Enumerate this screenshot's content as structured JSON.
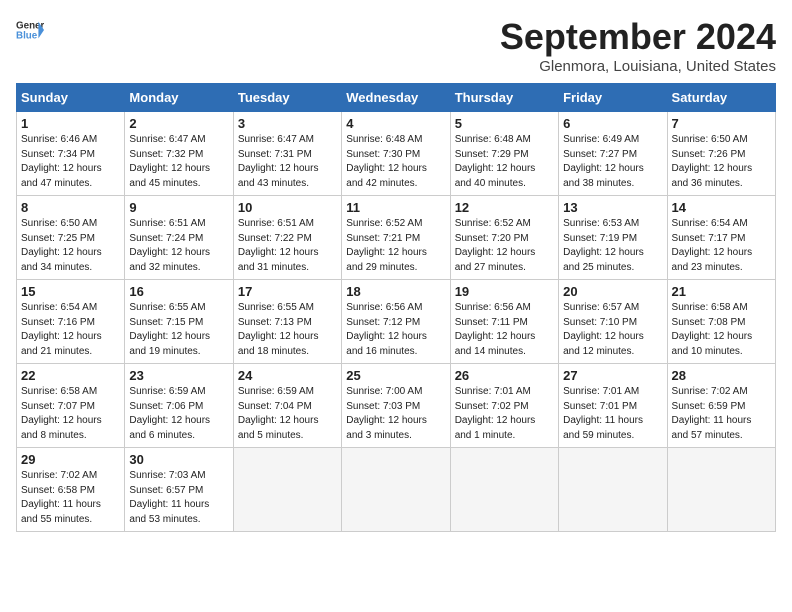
{
  "header": {
    "logo_line1": "General",
    "logo_line2": "Blue",
    "month": "September 2024",
    "location": "Glenmora, Louisiana, United States"
  },
  "weekdays": [
    "Sunday",
    "Monday",
    "Tuesday",
    "Wednesday",
    "Thursday",
    "Friday",
    "Saturday"
  ],
  "weeks": [
    [
      {
        "day": "1",
        "rise": "6:46 AM",
        "set": "7:34 PM",
        "hours": "12 hours",
        "mins": "47 minutes"
      },
      {
        "day": "2",
        "rise": "6:47 AM",
        "set": "7:32 PM",
        "hours": "12 hours",
        "mins": "45 minutes"
      },
      {
        "day": "3",
        "rise": "6:47 AM",
        "set": "7:31 PM",
        "hours": "12 hours",
        "mins": "43 minutes"
      },
      {
        "day": "4",
        "rise": "6:48 AM",
        "set": "7:30 PM",
        "hours": "12 hours",
        "mins": "42 minutes"
      },
      {
        "day": "5",
        "rise": "6:48 AM",
        "set": "7:29 PM",
        "hours": "12 hours",
        "mins": "40 minutes"
      },
      {
        "day": "6",
        "rise": "6:49 AM",
        "set": "7:27 PM",
        "hours": "12 hours",
        "mins": "38 minutes"
      },
      {
        "day": "7",
        "rise": "6:50 AM",
        "set": "7:26 PM",
        "hours": "12 hours",
        "mins": "36 minutes"
      }
    ],
    [
      {
        "day": "8",
        "rise": "6:50 AM",
        "set": "7:25 PM",
        "hours": "12 hours",
        "mins": "34 minutes"
      },
      {
        "day": "9",
        "rise": "6:51 AM",
        "set": "7:24 PM",
        "hours": "12 hours",
        "mins": "32 minutes"
      },
      {
        "day": "10",
        "rise": "6:51 AM",
        "set": "7:22 PM",
        "hours": "12 hours",
        "mins": "31 minutes"
      },
      {
        "day": "11",
        "rise": "6:52 AM",
        "set": "7:21 PM",
        "hours": "12 hours",
        "mins": "29 minutes"
      },
      {
        "day": "12",
        "rise": "6:52 AM",
        "set": "7:20 PM",
        "hours": "12 hours",
        "mins": "27 minutes"
      },
      {
        "day": "13",
        "rise": "6:53 AM",
        "set": "7:19 PM",
        "hours": "12 hours",
        "mins": "25 minutes"
      },
      {
        "day": "14",
        "rise": "6:54 AM",
        "set": "7:17 PM",
        "hours": "12 hours",
        "mins": "23 minutes"
      }
    ],
    [
      {
        "day": "15",
        "rise": "6:54 AM",
        "set": "7:16 PM",
        "hours": "12 hours",
        "mins": "21 minutes"
      },
      {
        "day": "16",
        "rise": "6:55 AM",
        "set": "7:15 PM",
        "hours": "12 hours",
        "mins": "19 minutes"
      },
      {
        "day": "17",
        "rise": "6:55 AM",
        "set": "7:13 PM",
        "hours": "12 hours",
        "mins": "18 minutes"
      },
      {
        "day": "18",
        "rise": "6:56 AM",
        "set": "7:12 PM",
        "hours": "12 hours",
        "mins": "16 minutes"
      },
      {
        "day": "19",
        "rise": "6:56 AM",
        "set": "7:11 PM",
        "hours": "12 hours",
        "mins": "14 minutes"
      },
      {
        "day": "20",
        "rise": "6:57 AM",
        "set": "7:10 PM",
        "hours": "12 hours",
        "mins": "12 minutes"
      },
      {
        "day": "21",
        "rise": "6:58 AM",
        "set": "7:08 PM",
        "hours": "12 hours",
        "mins": "10 minutes"
      }
    ],
    [
      {
        "day": "22",
        "rise": "6:58 AM",
        "set": "7:07 PM",
        "hours": "12 hours",
        "mins": "8 minutes"
      },
      {
        "day": "23",
        "rise": "6:59 AM",
        "set": "7:06 PM",
        "hours": "12 hours",
        "mins": "6 minutes"
      },
      {
        "day": "24",
        "rise": "6:59 AM",
        "set": "7:04 PM",
        "hours": "12 hours",
        "mins": "5 minutes"
      },
      {
        "day": "25",
        "rise": "7:00 AM",
        "set": "7:03 PM",
        "hours": "12 hours",
        "mins": "3 minutes"
      },
      {
        "day": "26",
        "rise": "7:01 AM",
        "set": "7:02 PM",
        "hours": "12 hours",
        "mins": "1 minute"
      },
      {
        "day": "27",
        "rise": "7:01 AM",
        "set": "7:01 PM",
        "hours": "11 hours",
        "mins": "59 minutes"
      },
      {
        "day": "28",
        "rise": "7:02 AM",
        "set": "6:59 PM",
        "hours": "11 hours",
        "mins": "57 minutes"
      }
    ],
    [
      {
        "day": "29",
        "rise": "7:02 AM",
        "set": "6:58 PM",
        "hours": "11 hours",
        "mins": "55 minutes"
      },
      {
        "day": "30",
        "rise": "7:03 AM",
        "set": "6:57 PM",
        "hours": "11 hours",
        "mins": "53 minutes"
      },
      null,
      null,
      null,
      null,
      null
    ]
  ]
}
